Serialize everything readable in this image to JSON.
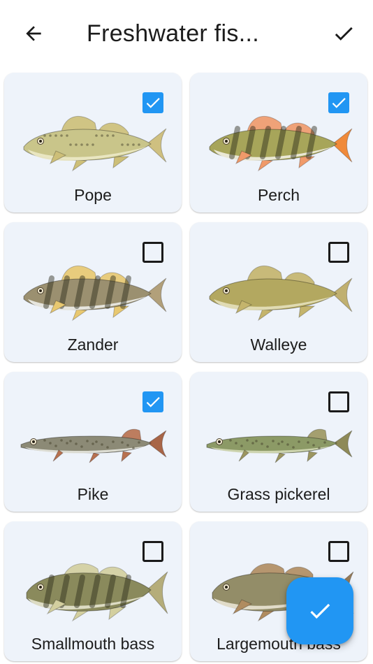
{
  "header": {
    "title": "Freshwater fis...",
    "back_icon": "arrow-left-icon",
    "done_icon": "check-icon"
  },
  "fish": [
    {
      "id": "pope",
      "name": "Pope",
      "checked": true,
      "body": "#c9c58a",
      "belly": "#ece9c6",
      "fin": "#cdbf78",
      "tail": "#cfc080",
      "stripes": false
    },
    {
      "id": "perch",
      "name": "Perch",
      "checked": true,
      "body": "#a7a55a",
      "belly": "#f2efe2",
      "fin": "#f09a6a",
      "tail": "#f08a3a",
      "stripes": true
    },
    {
      "id": "zander",
      "name": "Zander",
      "checked": false,
      "body": "#9b9070",
      "belly": "#eeeeea",
      "fin": "#e8c870",
      "tail": "#b2a07a",
      "stripes": true
    },
    {
      "id": "walleye",
      "name": "Walleye",
      "checked": false,
      "body": "#b3a860",
      "belly": "#e4e0bd",
      "fin": "#c4b46c",
      "tail": "#c0b070",
      "stripes": false
    },
    {
      "id": "pike",
      "name": "Pike",
      "checked": true,
      "body": "#8c8a76",
      "belly": "#e6e6de",
      "fin": "#b8714f",
      "tail": "#a86547",
      "stripes": false,
      "long": true
    },
    {
      "id": "grass-pickerel",
      "name": "Grass pickerel",
      "checked": false,
      "body": "#8c9a66",
      "belly": "#d4dab6",
      "fin": "#9c9660",
      "tail": "#8e8a58",
      "stripes": false,
      "long": true
    },
    {
      "id": "smallmouth-bass",
      "name": "Smallmouth bass",
      "checked": false,
      "body": "#8a8a5c",
      "belly": "#e6e4cf",
      "fin": "#d3cf9f",
      "tail": "#b5ad7a",
      "stripes": true,
      "bass": true
    },
    {
      "id": "largemouth-bass",
      "name": "Largemouth bass",
      "checked": false,
      "body": "#938d68",
      "belly": "#eae4d4",
      "fin": "#b08c60",
      "tail": "#987c58",
      "stripes": false,
      "bass": true
    }
  ],
  "fab": {
    "icon": "check-icon"
  },
  "colors": {
    "accent": "#2196f3",
    "card": "#eef3fa"
  }
}
